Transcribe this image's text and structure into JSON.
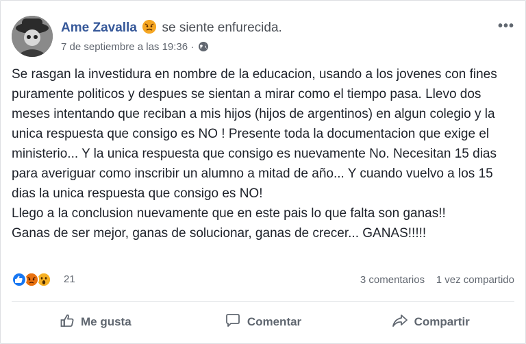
{
  "post": {
    "author": "Ame Zavalla",
    "feeling": "se siente enfurecida.",
    "feeling_icon": "angry-face-icon",
    "timestamp": "7 de septiembre a las 19:36 ·",
    "privacy_icon": "globe-icon",
    "body_paragraphs": [
      "Se rasgan la investidura en nombre de la educacion, usando a los jovenes con fines puramente politicos y despues se sientan a mirar como el tiempo pasa. Llevo dos meses intentando que reciban a mis hijos (hijos de argentinos) en algun colegio y la unica respuesta que consigo es NO ! Presente toda la documentacion que exige el ministerio... Y la unica respuesta que consigo es nuevamente No. Necesitan 15 dias para averiguar como inscribir un alumno a mitad de año... Y cuando vuelvo a los 15 dias la unica respuesta que consigo es NO!",
      "Llego a la conclusion nuevamente que en este pais lo que falta son ganas!!",
      "Ganas de ser mejor, ganas de solucionar, ganas de crecer... GANAS!!!!!"
    ]
  },
  "stats": {
    "reaction_icons": [
      "like-icon",
      "angry-icon",
      "wow-icon"
    ],
    "reaction_count": "21",
    "comments": "3 comentarios",
    "shares": "1 vez compartido"
  },
  "actions": {
    "like": "Me gusta",
    "comment": "Comentar",
    "share": "Compartir"
  },
  "colors": {
    "author": "#365899",
    "like": "#1877f2",
    "angry": "#e9710f",
    "wow": "#f7b125"
  }
}
